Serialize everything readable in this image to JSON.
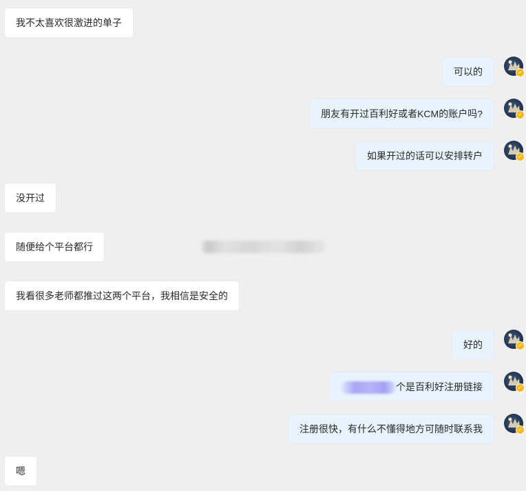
{
  "messages": [
    {
      "side": "in",
      "text": "我不太喜欢很激进的单子"
    },
    {
      "side": "out",
      "text": "可以的"
    },
    {
      "side": "out",
      "text": "朋友有开过百利好或者KCM的账户吗?"
    },
    {
      "side": "out",
      "text": "如果开过的话可以安排转户"
    },
    {
      "side": "in",
      "text": "没开过"
    },
    {
      "side": "in",
      "text": "随便给个平台都行"
    },
    {
      "side": "in",
      "text": "我看很多老师都推过这两个平台，我相信是安全的"
    },
    {
      "side": "out",
      "text": "好的"
    },
    {
      "side": "out",
      "text": "个是百利好注册链接",
      "redacted_prefix": true
    },
    {
      "side": "out",
      "text": "注册很快，有什么不懂得地方可随时联系我"
    },
    {
      "side": "in",
      "text": "嗯"
    }
  ],
  "avatar": {
    "icon": "avatar-icon",
    "badge_icon": "vip-badge-icon",
    "badge_color": "#f6b91d"
  },
  "colors": {
    "background": "#efefef",
    "incoming_bubble": "#ffffff",
    "outgoing_bubble": "#e8f3fd",
    "text": "#2a2a2a"
  }
}
